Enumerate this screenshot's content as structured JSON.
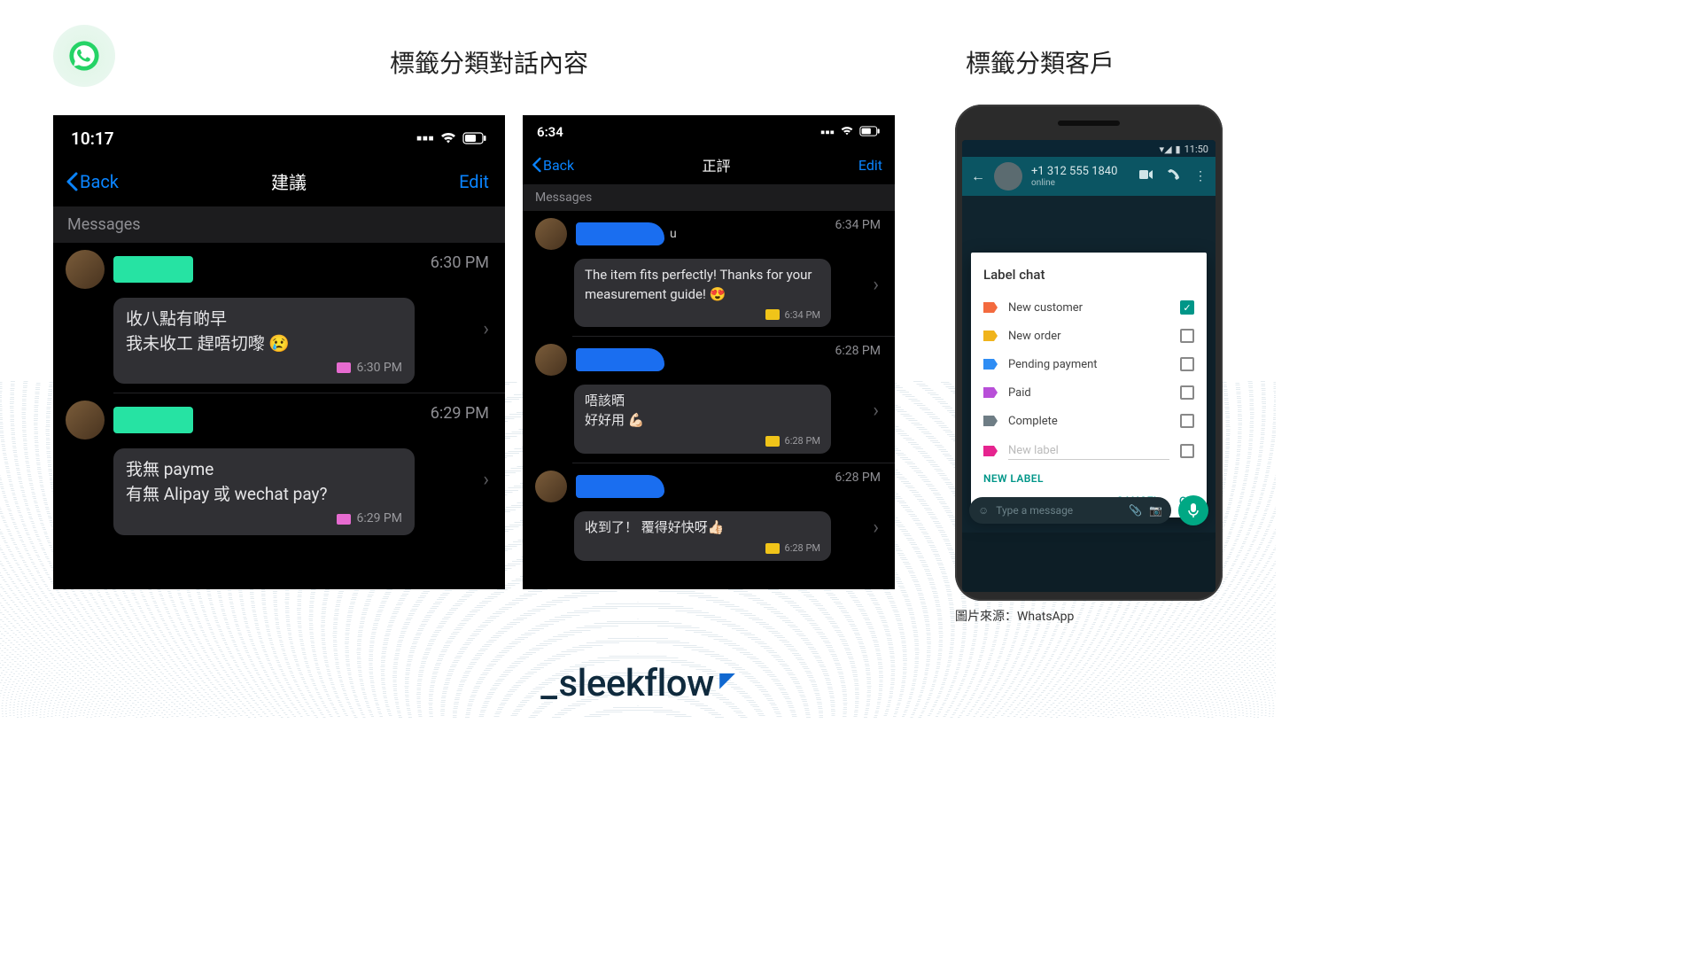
{
  "headings": {
    "left": "標籤分類對話內容",
    "right": "標籤分類客戶"
  },
  "phone1": {
    "time": "10:17",
    "back": "Back",
    "title": "建議",
    "edit": "Edit",
    "section": "Messages",
    "chats": [
      {
        "time": "6:30 PM",
        "lines": [
          "收八點有啲早",
          "我未收工 趕唔切嚟 😢"
        ],
        "tag_color": "tag-pink",
        "bubble_time": "6:30 PM"
      },
      {
        "time": "6:29 PM",
        "lines": [
          "我無 payme",
          "有無 Alipay 或 wechat pay?"
        ],
        "tag_color": "tag-pink",
        "bubble_time": "6:29 PM"
      }
    ]
  },
  "phone2": {
    "time": "6:34",
    "back": "Back",
    "title": "正評",
    "edit": "Edit",
    "section": "Messages",
    "chats": [
      {
        "name_suffix": "u",
        "time": "6:34 PM",
        "lines": [
          "The item fits perfectly! Thanks for your measurement guide! 😍"
        ],
        "tag_color": "tag-yellow",
        "bubble_time": "6:34 PM"
      },
      {
        "name_suffix": "",
        "time": "6:28 PM",
        "lines": [
          "唔該晒",
          "好好用 💪🏻"
        ],
        "tag_color": "tag-yellow",
        "bubble_time": "6:28 PM"
      },
      {
        "name_suffix": "",
        "time": "6:28 PM",
        "lines": [
          "收到了！ 覆得好快呀👍🏻"
        ],
        "tag_color": "tag-yellow",
        "bubble_time": "6:28 PM"
      }
    ]
  },
  "phone3": {
    "status_time": "11:50",
    "number": "+1 312 555 1840",
    "presence": "online",
    "dialog_title": "Label chat",
    "labels": [
      {
        "name": "New customer",
        "color": "#f36a3e",
        "checked": true
      },
      {
        "name": "New order",
        "color": "#f0b41c",
        "checked": false
      },
      {
        "name": "Pending payment",
        "color": "#2f8df4",
        "checked": false
      },
      {
        "name": "Paid",
        "color": "#b84fd8",
        "checked": false
      },
      {
        "name": "Complete",
        "color": "#6e7d85",
        "checked": false
      }
    ],
    "new_label_placeholder": "New label",
    "new_label_link": "NEW LABEL",
    "cancel": "CANCEL",
    "ok": "OK",
    "composer_placeholder": "Type a message"
  },
  "credit": "圖片來源：WhatsApp",
  "brand": "sleekflow"
}
